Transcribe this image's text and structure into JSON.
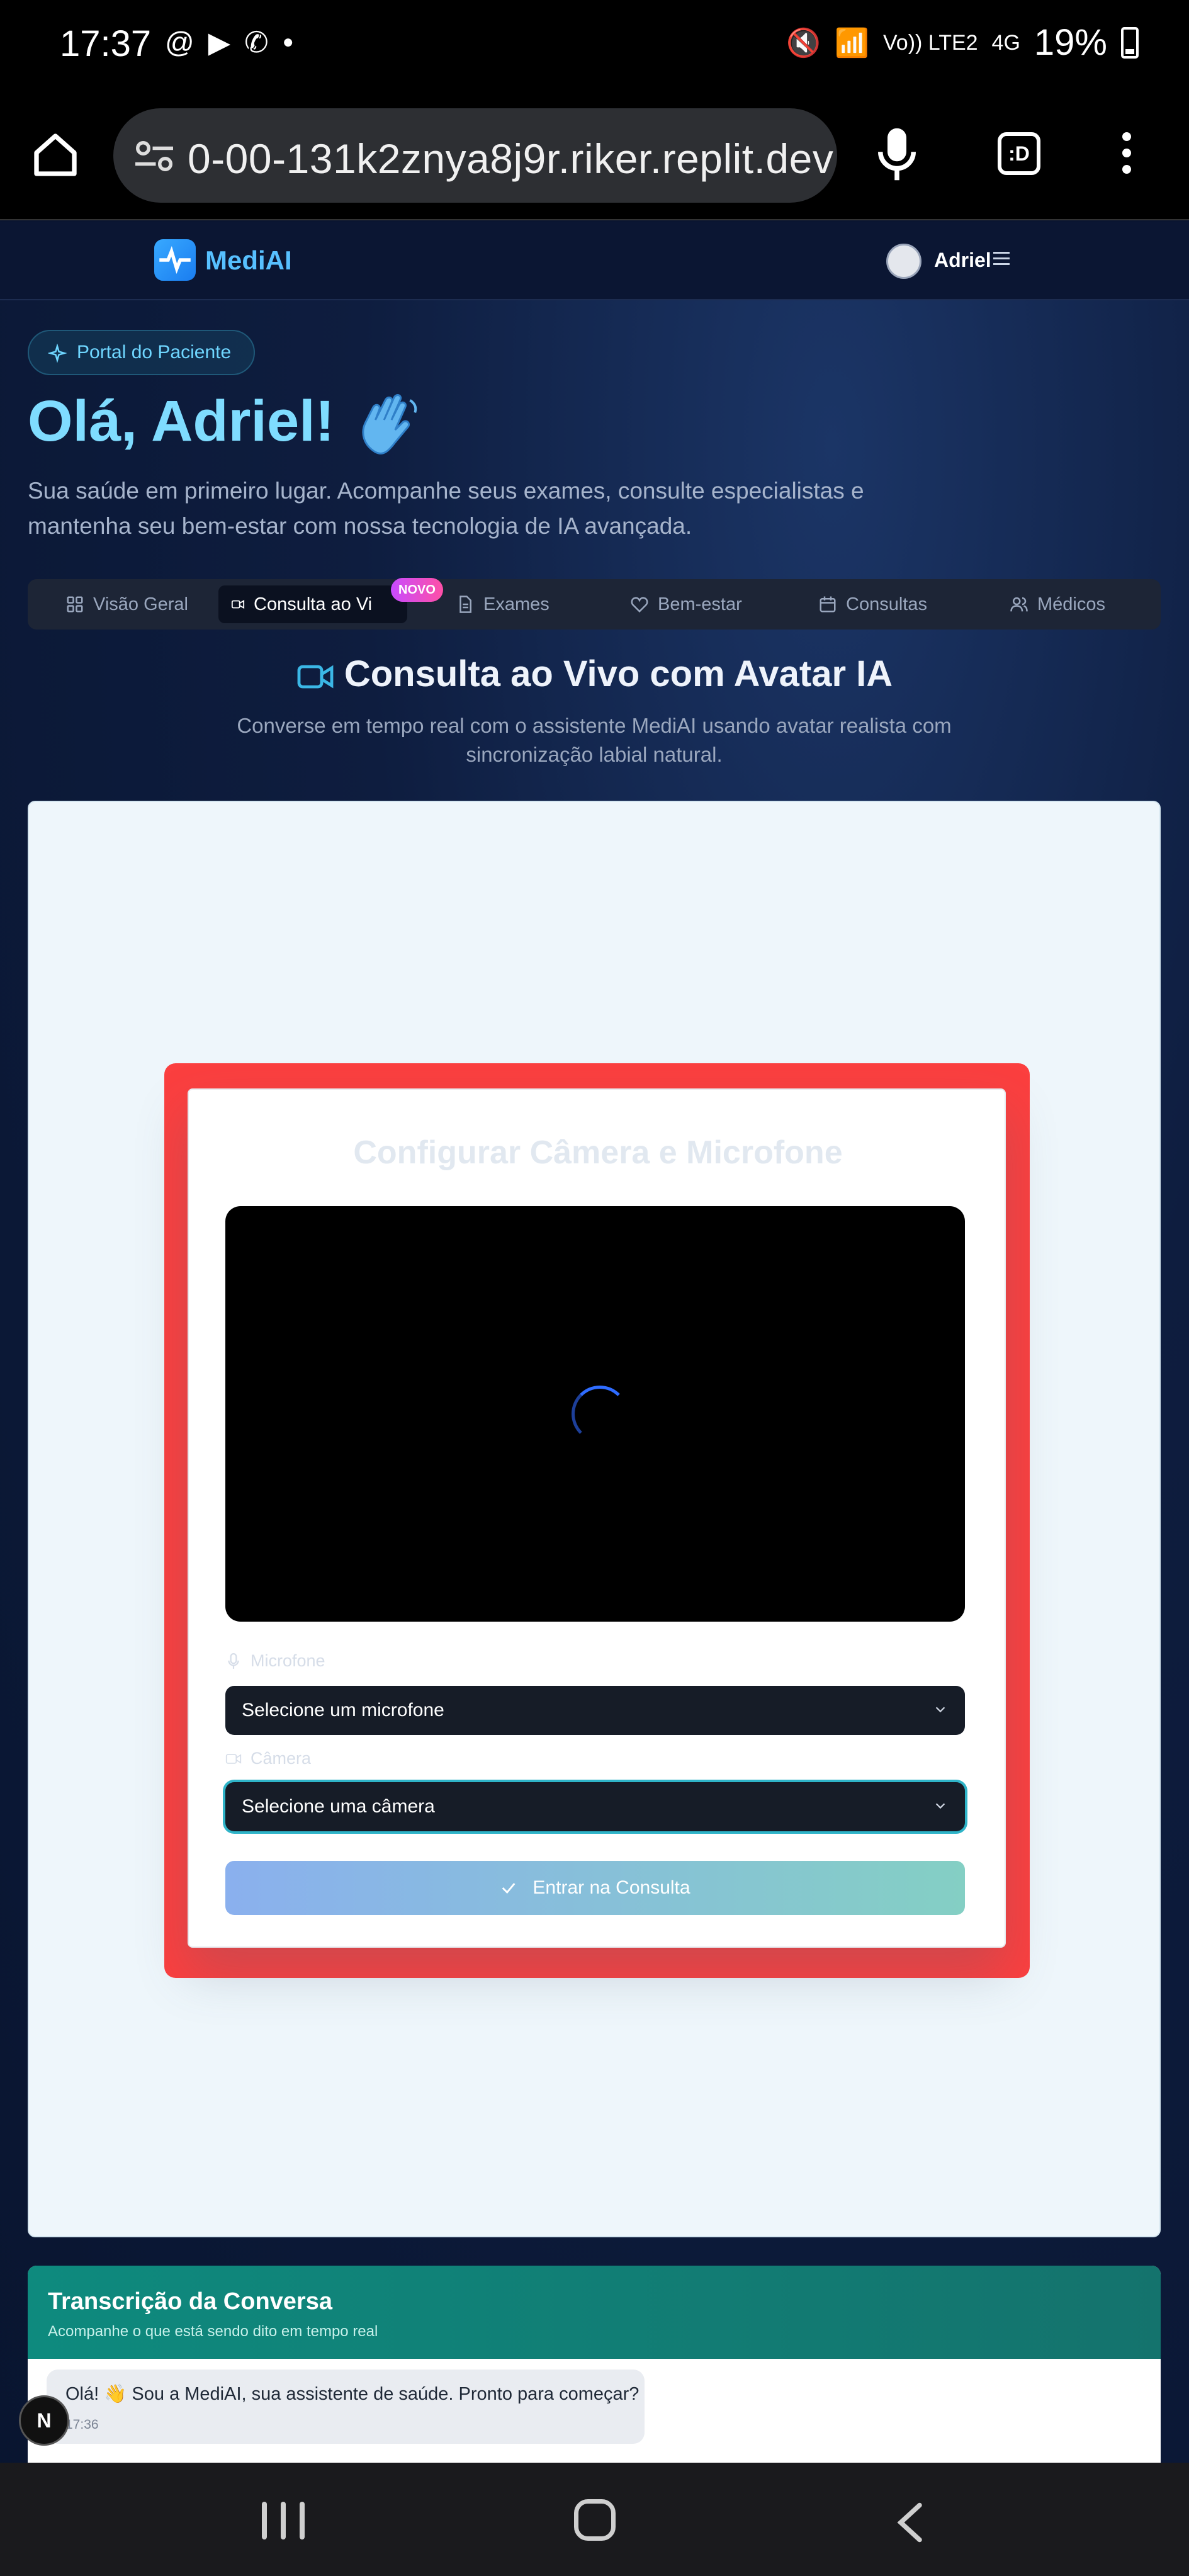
{
  "status_bar": {
    "time": "17:37",
    "network": "Vo)) LTE2",
    "net_type": "4G",
    "battery": "19%"
  },
  "browser": {
    "url": "0-00-131k2znya8j9r.riker.replit.dev",
    "tab_label": ":D"
  },
  "header": {
    "app_name": "MediAI",
    "user_name": "Adriel"
  },
  "hero": {
    "badge": "Portal do Paciente",
    "greeting": "Olá, Adriel!",
    "subtitle": "Sua saúde em primeiro lugar. Acompanhe seus exames, consulte especialistas e mantenha seu bem-estar com nossa tecnologia de IA avançada."
  },
  "tabs": [
    {
      "label": "Visão Geral",
      "icon": "grid-icon"
    },
    {
      "label": "Consulta ao Vi",
      "icon": "video-icon",
      "badge": "NOVO"
    },
    {
      "label": "Exames",
      "icon": "file-icon"
    },
    {
      "label": "Bem-estar",
      "icon": "heart-icon"
    },
    {
      "label": "Consultas",
      "icon": "calendar-icon"
    },
    {
      "label": "Médicos",
      "icon": "users-icon"
    }
  ],
  "consult": {
    "title": "Consulta ao Vivo com Avatar IA",
    "description": "Converse em tempo real com o assistente MediAI usando avatar realista com sincronização labial natural."
  },
  "setup": {
    "title": "Configurar Câmera e Microfone",
    "mic_label": "Microfone",
    "mic_value": "Selecione um microfone",
    "cam_label": "Câmera",
    "cam_value": "Selecione uma câmera",
    "enter_label": "Entrar na Consulta"
  },
  "transcript": {
    "title": "Transcrição da Conversa",
    "subtitle": "Acompanhe o que está sendo dito em tempo real",
    "message": "Olá! 👋 Sou a MediAI, sua assistente de saúde. Pronto para começar?",
    "message_time": "17:36"
  },
  "floating_badge": "N",
  "colors": {
    "accent": "#57c0ff",
    "highlight_frame": "#fb3f3f",
    "transcript_header": "#0e8a7e"
  }
}
